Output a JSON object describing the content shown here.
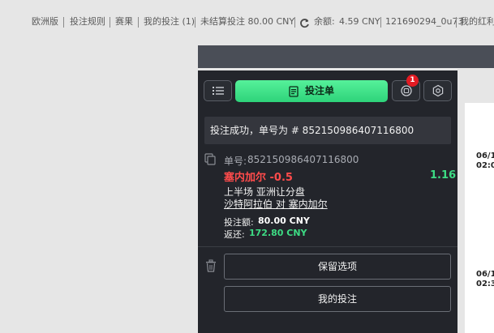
{
  "topnav": {
    "europe": "欧洲版",
    "rules": "投注规则",
    "results": "赛果",
    "my_bets": "我的投注 (1)",
    "unsettled": "未结算投注 80.00 CNY",
    "balance_label": "余额:",
    "balance_value": "4.59 CNY",
    "account": "121690294_0u73",
    "bonus": "我的红利"
  },
  "toolbar": {
    "betslip_label": "投注单",
    "notification_count": "1"
  },
  "success_message": "投注成功，单号为 # 852150986407116800",
  "bet": {
    "ticket_label": "单号:",
    "ticket_number": "852150986407116800",
    "selection": "塞内加尔 -0.5",
    "odds": "1.16",
    "market": "上半场 亚洲让分盘",
    "match": "沙特阿拉伯 对 塞内加尔",
    "stake_label": "投注额:",
    "stake_value": "80.00 CNY",
    "return_label": "返还:",
    "return_value": "172.80 CNY"
  },
  "actions": {
    "keep_selections": "保留选项",
    "my_bets": "我的投注"
  },
  "right_times": [
    {
      "date": "06/1",
      "time": "02:0"
    },
    {
      "date": "06/1",
      "time": "02:3"
    }
  ],
  "colors": {
    "accent_green": "#3ddc84",
    "selection_red": "#ff4b4b",
    "badge_red": "#e31b23",
    "panel_bg": "#23252b"
  }
}
